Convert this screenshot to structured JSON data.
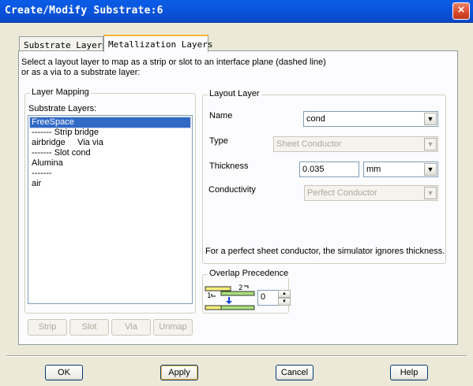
{
  "window": {
    "title": "Create/Modify Substrate:6",
    "close_glyph": "×"
  },
  "tabs": [
    {
      "label": "Substrate Layers",
      "active": false
    },
    {
      "label": "Metallization Layers",
      "active": true
    }
  ],
  "description": {
    "line1": "Select a layout layer to map as a strip or slot to an interface plane (dashed line)",
    "line2": "or as a via to a substrate layer:"
  },
  "layer_mapping": {
    "group_label": "Layer Mapping",
    "list_label": "Substrate Layers:",
    "items": [
      "FreeSpace",
      "------- Strip bridge",
      "airbridge     Via via",
      "------- Slot cond",
      "Alumina",
      "-------",
      "air"
    ],
    "selected_index": 0,
    "buttons": {
      "strip": "Strip",
      "slot": "Slot",
      "via": "Via",
      "unmap": "Unmap"
    }
  },
  "layout_layer": {
    "group_label": "Layout Layer",
    "name_label": "Name",
    "name_value": "cond",
    "type_label": "Type",
    "type_value": "Sheet Conductor",
    "thickness_label": "Thickness",
    "thickness_value": "0.035",
    "thickness_unit": "mm",
    "conductivity_label": "Conductivity",
    "conductivity_value": "Perfect Conductor",
    "note": "For a perfect sheet conductor, the simulator ignores thickness."
  },
  "overlap": {
    "group_label": "Overlap Precedence",
    "marker_top": "2",
    "marker_bottom": "1",
    "value": "0"
  },
  "footer": {
    "ok": "OK",
    "apply": "Apply",
    "cancel": "Cancel",
    "help": "Help"
  },
  "colors": {
    "titlebar": "#0A5CE6",
    "selection": "#316AC5",
    "tab_highlight": "#F8B636",
    "overlap_green": "#A8E07A",
    "overlap_yellow": "#F6F07A",
    "overlap_arrow": "#1040E0"
  }
}
